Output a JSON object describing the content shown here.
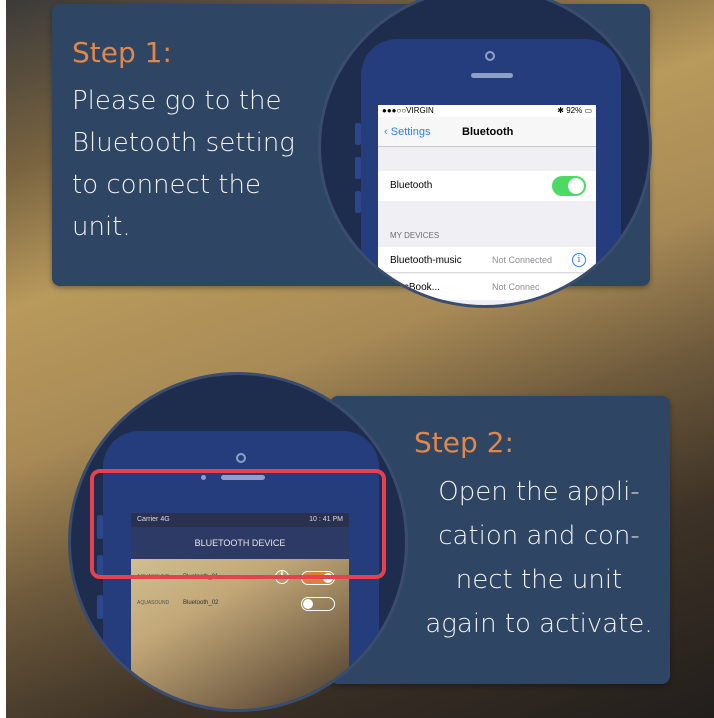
{
  "colors": {
    "accent_orange": "#e0874a",
    "card_bg": "#2f4564",
    "highlight_red": "#e8404f",
    "ios_toggle_green": "#4cd964",
    "app_toggle_orange": "#d6843c"
  },
  "step1": {
    "title": "Step 1:",
    "body": "Please go to the\nBluetooth setting\nto connect the\nunit."
  },
  "step2": {
    "title": "Step 2:",
    "body": "Open the appli-\ncation and con-\nnect the unit\nagain to activate."
  },
  "ios": {
    "carrier": "●●●○○VIRGIN",
    "battery": "✱ 92% ▭",
    "back_label": "Settings",
    "title": "Bluetooth",
    "bluetooth_label": "Bluetooth",
    "bluetooth_on": true,
    "section_label": "MY DEVICES",
    "devices": [
      {
        "name": "Bluetooth-music",
        "status": "Not Connected"
      },
      {
        "name": "MacBook...",
        "status": "Not Connec"
      }
    ],
    "info_icon": "i"
  },
  "app": {
    "carrier": "Carrier 4G",
    "time": "10 : 41 PM",
    "header": "BLUETOOTH DEVICE",
    "devices": [
      {
        "brand": "AQUASOUND",
        "name": "Bluetooth_01",
        "on": true
      },
      {
        "brand": "AQUASOUND",
        "name": "Bluetooth_02",
        "on": false
      }
    ],
    "info_icon": "i"
  }
}
